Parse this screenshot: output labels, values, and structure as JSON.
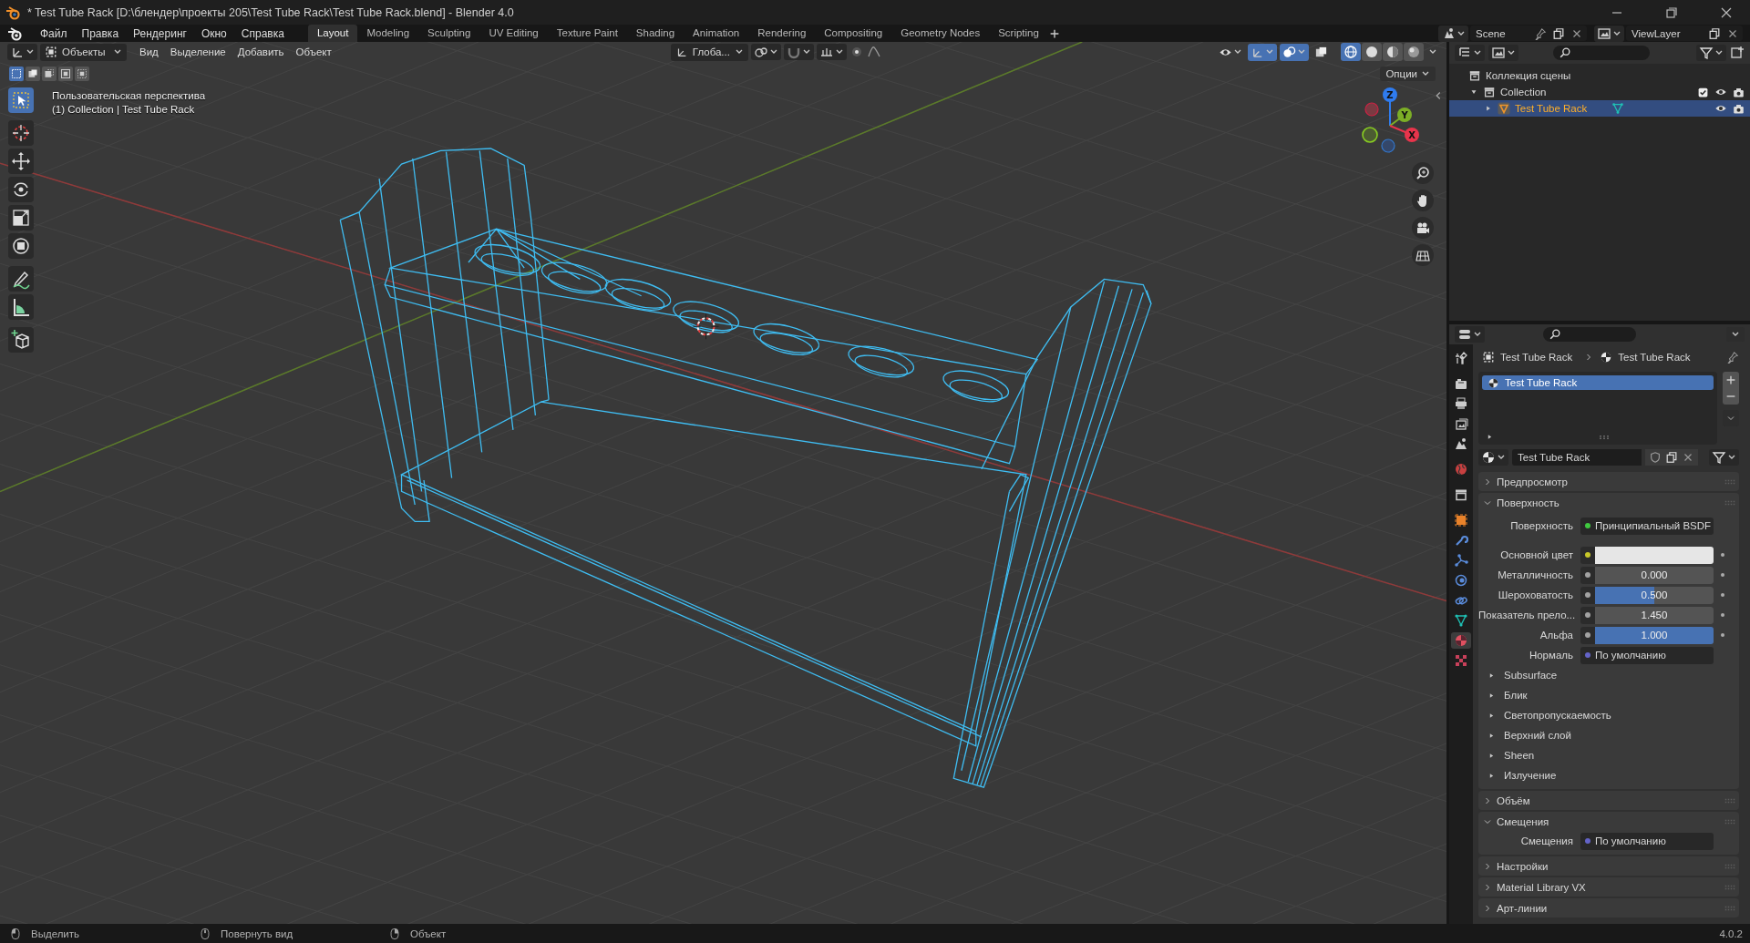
{
  "window": {
    "title": "* Test Tube Rack [D:\\блендер\\проекты 205\\Test Tube Rack\\Test Tube Rack.blend] - Blender 4.0"
  },
  "menu": [
    "Файл",
    "Правка",
    "Рендеринг",
    "Окно",
    "Справка"
  ],
  "workspaces": [
    {
      "label": "Layout",
      "selected": true
    },
    {
      "label": "Modeling",
      "selected": false
    },
    {
      "label": "Sculpting",
      "selected": false
    },
    {
      "label": "UV Editing",
      "selected": false
    },
    {
      "label": "Texture Paint",
      "selected": false
    },
    {
      "label": "Shading",
      "selected": false
    },
    {
      "label": "Animation",
      "selected": false
    },
    {
      "label": "Rendering",
      "selected": false
    },
    {
      "label": "Compositing",
      "selected": false
    },
    {
      "label": "Geometry Nodes",
      "selected": false
    },
    {
      "label": "Scripting",
      "selected": false
    }
  ],
  "scene": "Scene",
  "view_layer": "ViewLayer",
  "viewport": {
    "mode": "Объекты",
    "menus": [
      "Вид",
      "Выделение",
      "Добавить",
      "Объект"
    ],
    "orientation": "Глоба...",
    "snapping": {
      "on": false
    },
    "toggles": [
      {
        "kind": "visibility",
        "on": false
      },
      {
        "kind": "gizmos",
        "on": true
      },
      {
        "kind": "overlays",
        "on": true
      },
      {
        "kind": "xray",
        "on": false
      }
    ],
    "shading": [
      {
        "kind": "wireframe",
        "selected": true
      },
      {
        "kind": "solid",
        "selected": false
      },
      {
        "kind": "material",
        "selected": false
      },
      {
        "kind": "rendered",
        "selected": false
      }
    ],
    "selection_modes": [
      {
        "kind": "set",
        "selected": true
      },
      {
        "kind": "extend",
        "selected": false
      },
      {
        "kind": "subtract",
        "selected": false
      },
      {
        "kind": "invert",
        "selected": false
      },
      {
        "kind": "intersect",
        "selected": false
      }
    ],
    "options": "Опции",
    "view_name": "Пользовательская перспектива",
    "collection_info": "(1) Collection | Test Tube Rack",
    "tools": [
      {
        "kind": "select_box",
        "selected": true
      },
      {
        "kind": "cursor",
        "selected": false
      },
      {
        "kind": "move",
        "selected": false
      },
      {
        "kind": "rotate",
        "selected": false
      },
      {
        "kind": "scale",
        "selected": false
      },
      {
        "kind": "transform",
        "selected": false
      },
      {
        "kind": "annotate",
        "selected": false
      },
      {
        "kind": "measure",
        "selected": false
      },
      {
        "kind": "add_cube",
        "selected": false
      }
    ],
    "gizmo": [
      {
        "label": "Z",
        "color": "#2f7cf0"
      },
      {
        "label": "Y",
        "color": "#7cae26"
      },
      {
        "label": "X",
        "color": "#e8344b"
      }
    ]
  },
  "outliner": {
    "items": [
      {
        "kind": "scene_collection",
        "label": "Коллекция сцены",
        "selected": false,
        "children": [
          {
            "kind": "collection",
            "label": "Collection",
            "selected": false,
            "expanded": true,
            "children": [
              {
                "kind": "object",
                "label": "Test Tube Rack",
                "selected": true,
                "expanded": false
              }
            ]
          }
        ]
      }
    ]
  },
  "properties": {
    "tabs": [
      {
        "kind": "tool",
        "selected": false
      },
      {
        "kind": "render",
        "selected": false
      },
      {
        "kind": "output",
        "selected": false
      },
      {
        "kind": "view_layer",
        "selected": false
      },
      {
        "kind": "scene",
        "selected": false
      },
      {
        "kind": "world",
        "selected": false
      },
      {
        "kind": "collection",
        "selected": false
      },
      {
        "kind": "object",
        "selected": false
      },
      {
        "kind": "modifiers",
        "selected": false
      },
      {
        "kind": "particles",
        "selected": false
      },
      {
        "kind": "physics",
        "selected": false
      },
      {
        "kind": "constraints",
        "selected": false
      },
      {
        "kind": "data",
        "selected": false
      },
      {
        "kind": "material",
        "selected": true
      },
      {
        "kind": "texture",
        "selected": false
      }
    ],
    "breadcrumb": [
      "Test Tube Rack",
      "Test Tube Rack"
    ],
    "material_slots": [
      {
        "label": "Test Tube Rack",
        "selected": true
      }
    ],
    "material_name": "Test Tube Rack",
    "panels": [
      {
        "title": "Предпросмотр",
        "expanded": false
      },
      {
        "title": "Поверхность",
        "expanded": true,
        "rows": [
          {
            "kind": "link",
            "label": "Поверхность",
            "value": "Принципиальный BSDF",
            "color": "#3fc93f"
          },
          {
            "kind": "color",
            "label": "Основной цвет",
            "color": "#c7c729"
          },
          {
            "kind": "slider",
            "label": "Металличность",
            "value": "0.000",
            "level": 0,
            "color": "#a1a1a1"
          },
          {
            "kind": "slider",
            "label": "Шероховатость",
            "value": "0.500",
            "level": 0.5,
            "color": "#a1a1a1"
          },
          {
            "kind": "number",
            "label": "Показатель прело...",
            "value": "1.450",
            "color": "#a1a1a1"
          },
          {
            "kind": "slider",
            "label": "Альфа",
            "value": "1.000",
            "level": 1,
            "color": "#a1a1a1"
          },
          {
            "kind": "link",
            "label": "Нормаль",
            "value": "По умолчанию",
            "color": "#6363c7"
          },
          {
            "kind": "subpanel",
            "label": "Subsurface",
            "expanded": false
          },
          {
            "kind": "subpanel",
            "label": "Блик",
            "expanded": false
          },
          {
            "kind": "subpanel",
            "label": "Светопропускаемость",
            "expanded": false
          },
          {
            "kind": "subpanel",
            "label": "Верхний слой",
            "expanded": false
          },
          {
            "kind": "subpanel",
            "label": "Sheen",
            "expanded": false
          },
          {
            "kind": "subpanel",
            "label": "Излучение",
            "expanded": false
          }
        ]
      },
      {
        "title": "Объём",
        "expanded": false
      },
      {
        "title": "Смещения",
        "expanded": true,
        "rows": [
          {
            "kind": "link",
            "label": "Смещения",
            "value": "По умолчанию",
            "color": "#6363c7"
          }
        ]
      },
      {
        "title": "Настройки",
        "expanded": false
      },
      {
        "title": "Material Library VX",
        "expanded": false
      },
      {
        "title": "Арт-линии",
        "expanded": false
      }
    ]
  },
  "status_bar": {
    "hints": [
      {
        "kind": "left_mouse",
        "label": "Выделить"
      },
      {
        "kind": "middle_mouse",
        "label": "Повернуть вид"
      },
      {
        "kind": "right_mouse",
        "label": "Объект"
      }
    ],
    "version": "4.0.2"
  }
}
